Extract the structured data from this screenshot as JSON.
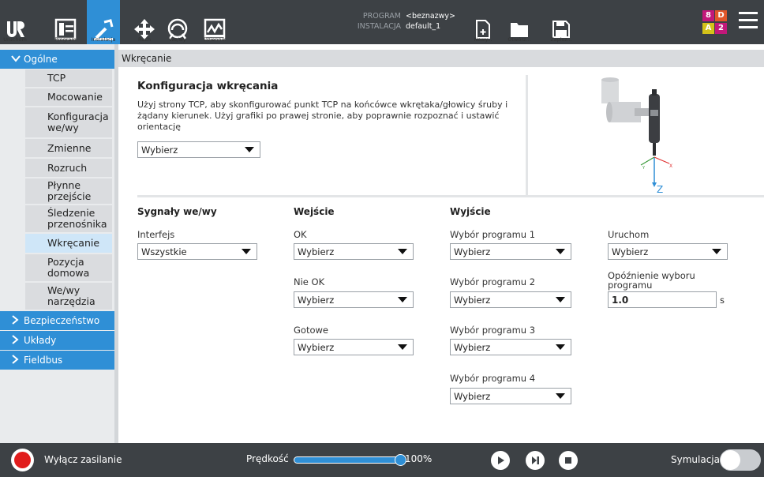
{
  "topbar": {
    "buttons": [
      {
        "label": "Uruchom",
        "icon": "ur-logo-icon"
      },
      {
        "label": "Program",
        "icon": "program-icon"
      },
      {
        "label": "Instalacja",
        "icon": "installation-icon"
      },
      {
        "label": "Ruch",
        "icon": "move-icon"
      },
      {
        "label": "We/wy",
        "icon": "io-icon"
      },
      {
        "label": "Dziennik",
        "icon": "log-icon"
      }
    ],
    "program_key": "PROGRAM",
    "program_value": "<beznazwy>",
    "installation_key": "INSTALACJA",
    "installation_value": "default_1",
    "file_buttons": [
      {
        "label": "Nowy...",
        "icon": "new-file-icon"
      },
      {
        "label": "Otwórz...",
        "icon": "open-folder-icon"
      },
      {
        "label": "Zapisz...",
        "icon": "save-icon"
      }
    ],
    "badges": [
      "8",
      "D",
      "A",
      "2"
    ],
    "badge_colors": [
      "#c2187a",
      "#e0562a",
      "#d4c21a",
      "#c2187a"
    ],
    "accent": "#2f8fd6"
  },
  "sidebar": {
    "groups": [
      {
        "label": "Ogólne",
        "expanded": true
      },
      {
        "label": "Bezpieczeństwo",
        "expanded": false
      },
      {
        "label": "Układy",
        "expanded": false
      },
      {
        "label": "Fieldbus",
        "expanded": false
      }
    ],
    "items": [
      {
        "label": "TCP"
      },
      {
        "label": "Mocowanie"
      },
      {
        "label": "Konfiguracja we/wy"
      },
      {
        "label": "Zmienne"
      },
      {
        "label": "Rozruch"
      },
      {
        "label": "Płynne przejście"
      },
      {
        "label": "Śledzenie przenośnika"
      },
      {
        "label": "Wkręcanie"
      },
      {
        "label": "Pozycja domowa"
      },
      {
        "label": "We/wy narzędzia"
      }
    ],
    "active_item": "Wkręcanie"
  },
  "page": {
    "header": "Wkręcanie",
    "title": "Konfiguracja wkręcania",
    "description": "Użyj strony TCP, aby skonfigurować punkt TCP na końcówce wkrętaka/głowicy śruby i żądany kierunek. Użyj grafiki po prawej stronie, aby poprawnie rozpoznać i ustawić orientację",
    "tcp_select": "Wybierz",
    "axis_label": "Z"
  },
  "signals": {
    "section_label": "Sygnały we/wy",
    "interface_label": "Interfejs",
    "interface_value": "Wszystkie",
    "input_header": "Wejście",
    "ok_label": "OK",
    "ok_value": "Wybierz",
    "nok_label": "Nie OK",
    "nok_value": "Wybierz",
    "ready_label": "Gotowe",
    "ready_value": "Wybierz",
    "output_header": "Wyjście",
    "prog1_label": "Wybór programu 1",
    "prog1_value": "Wybierz",
    "prog2_label": "Wybór programu 2",
    "prog2_value": "Wybierz",
    "prog3_label": "Wybór programu 3",
    "prog3_value": "Wybierz",
    "prog4_label": "Wybór programu 4",
    "prog4_value": "Wybierz",
    "start_label": "Uruchom",
    "start_value": "Wybierz",
    "delay_label": "Opóźnienie wyboru programu",
    "delay_value": "1.0",
    "delay_unit": "s"
  },
  "bottombar": {
    "power_label": "Wyłącz zasilanie",
    "speed_label": "Prędkość",
    "speed_value": "100%",
    "speed_fraction": 1.0,
    "simulation_label": "Symulacja",
    "simulation_on": false
  }
}
